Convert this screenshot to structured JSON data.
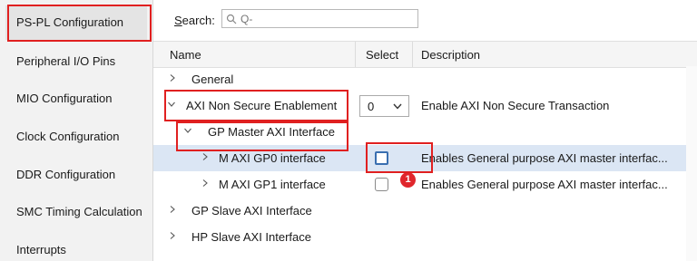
{
  "sidebar": {
    "items": [
      {
        "label": "PS-PL Configuration"
      },
      {
        "label": "Peripheral I/O Pins"
      },
      {
        "label": "MIO Configuration"
      },
      {
        "label": "Clock Configuration"
      },
      {
        "label": "DDR Configuration"
      },
      {
        "label": "SMC Timing Calculation"
      },
      {
        "label": "Interrupts"
      }
    ]
  },
  "search": {
    "label_underlined": "S",
    "label_rest": "earch:",
    "placeholder": "Q-"
  },
  "table": {
    "columns": {
      "name": "Name",
      "select": "Select",
      "description": "Description"
    },
    "rows": [
      {
        "name": "General",
        "expanded": false
      },
      {
        "name": "AXI Non Secure Enablement",
        "expanded": true,
        "select": "0",
        "description": "Enable AXI Non Secure Transaction"
      },
      {
        "name": "GP Master AXI Interface",
        "expanded": true
      },
      {
        "name": "M AXI GP0 interface",
        "expanded": false,
        "checked": false,
        "description": "Enables General purpose AXI master interfac..."
      },
      {
        "name": "M AXI GP1 interface",
        "expanded": false,
        "checked": false,
        "description": "Enables General purpose AXI master interfac..."
      },
      {
        "name": "GP Slave AXI Interface",
        "expanded": false
      },
      {
        "name": "HP Slave AXI Interface",
        "expanded": false
      }
    ]
  },
  "annotation": {
    "badge": "1"
  },
  "colors": {
    "highlight": "#e02020",
    "selected_row": "#dbe6f4",
    "badge": "#e0262c"
  }
}
